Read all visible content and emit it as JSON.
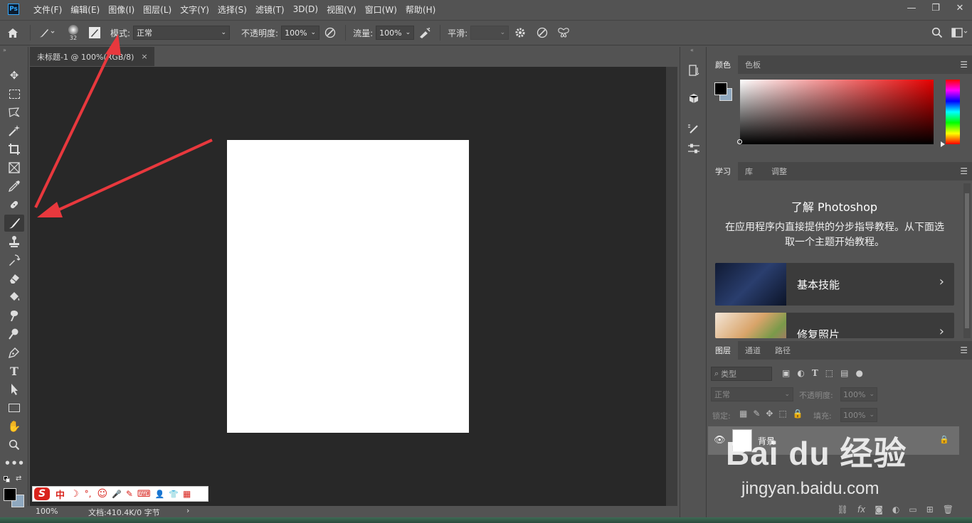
{
  "app": {
    "logo_text": "Ps"
  },
  "menu": [
    "文件(F)",
    "编辑(E)",
    "图像(I)",
    "图层(L)",
    "文字(Y)",
    "选择(S)",
    "滤镜(T)",
    "3D(D)",
    "视图(V)",
    "窗口(W)",
    "帮助(H)"
  ],
  "window_controls": {
    "minimize": "—",
    "restore": "❐",
    "close": "✕"
  },
  "options": {
    "brush_size": "32",
    "mode_label": "模式:",
    "mode_value": "正常",
    "opacity_label": "不透明度:",
    "opacity_value": "100%",
    "flow_label": "流量:",
    "flow_value": "100%",
    "smooth_label": "平滑:",
    "smooth_value": ""
  },
  "document": {
    "tab_title": "未标题-1 @ 100%(RGB/8)",
    "tab_close": "×",
    "status_zoom": "100%",
    "status_info": "文档:410.4K/0 字节",
    "status_arrow": "›"
  },
  "tools": [
    "move",
    "marquee",
    "lasso",
    "magic-wand",
    "crop",
    "frame",
    "eyedropper",
    "healing",
    "brush",
    "stamp",
    "history-brush",
    "eraser",
    "paint-bucket",
    "smudge",
    "dodge",
    "pen",
    "type",
    "path-select",
    "rectangle",
    "hand",
    "zoom",
    "more"
  ],
  "color_panel": {
    "tabs": [
      "颜色",
      "色板"
    ],
    "foreground": "#000000",
    "background": "#8fa8bf"
  },
  "learn_panel": {
    "tabs": [
      "学习",
      "库",
      "调整"
    ],
    "title": "了解 Photoshop",
    "description": "在应用程序内直接提供的分步指导教程。从下面选取一个主题开始教程。",
    "cards": [
      {
        "label": "基本技能",
        "thumb_color": "#1c2a4a"
      },
      {
        "label": "修复照片",
        "thumb_color": "#e6c8a8"
      }
    ]
  },
  "layers_panel": {
    "tabs": [
      "图层",
      "通道",
      "路径"
    ],
    "filter_label": "类型",
    "blend_value": "正常",
    "opacity_label": "不透明度:",
    "opacity_value": "100%",
    "lock_label": "锁定:",
    "fill_label": "填充:",
    "fill_value": "100%",
    "layers": [
      {
        "name": "背景"
      }
    ],
    "footer_fx": "fx"
  },
  "ime_bar": {
    "logo": "S",
    "items": [
      "中",
      "☽",
      "°,",
      "☺",
      "🎤",
      "✎",
      "⌨",
      "👤",
      "👕",
      "▦"
    ]
  },
  "watermark": {
    "logo_text": "Bai du 经验",
    "url": "jingyan.baidu.com"
  },
  "colors": {
    "ui_bg": "#535353",
    "doc_bg": "#282828",
    "annotation_red": "#e8383d",
    "ime_red": "#d9231c"
  }
}
